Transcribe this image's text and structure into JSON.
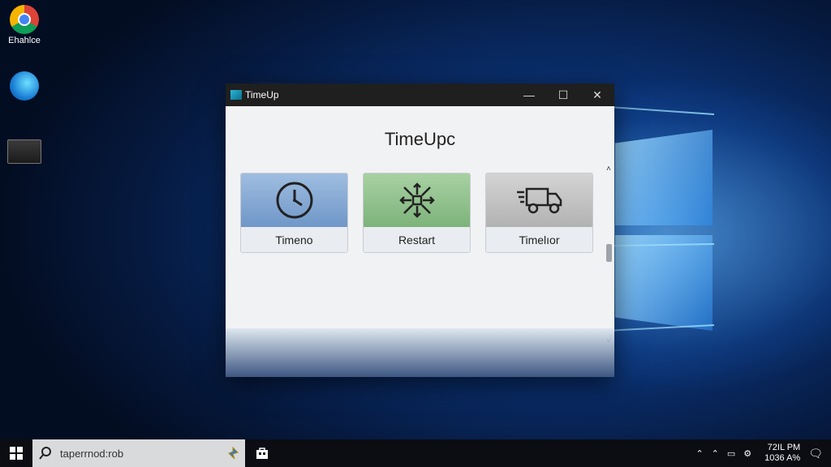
{
  "desktop": {
    "icons": [
      {
        "label": "Ehahlce",
        "icon": "chrome-icon"
      },
      {
        "label": "",
        "icon": "edge-icon"
      },
      {
        "label": "",
        "icon": "vm-icon"
      }
    ]
  },
  "window": {
    "title": "TimeUp",
    "controls": {
      "minimize": "—",
      "maximize": "☐",
      "close": "✕"
    },
    "app_title": "TimeUpc",
    "cards": [
      {
        "label": "Timeno",
        "icon": "clock-icon",
        "color": "#7fa4d0"
      },
      {
        "label": "Restart",
        "icon": "restart-arrows-icon",
        "color": "#8fbd8a"
      },
      {
        "label": "Timelıor",
        "icon": "truck-icon",
        "color": "#bcbcbc"
      }
    ],
    "scroll": {
      "up": "˄",
      "down": "˅"
    }
  },
  "taskbar": {
    "search_text": "taperrnod:rob",
    "clock_time": "72IL PM",
    "clock_date": "1036 A%"
  }
}
